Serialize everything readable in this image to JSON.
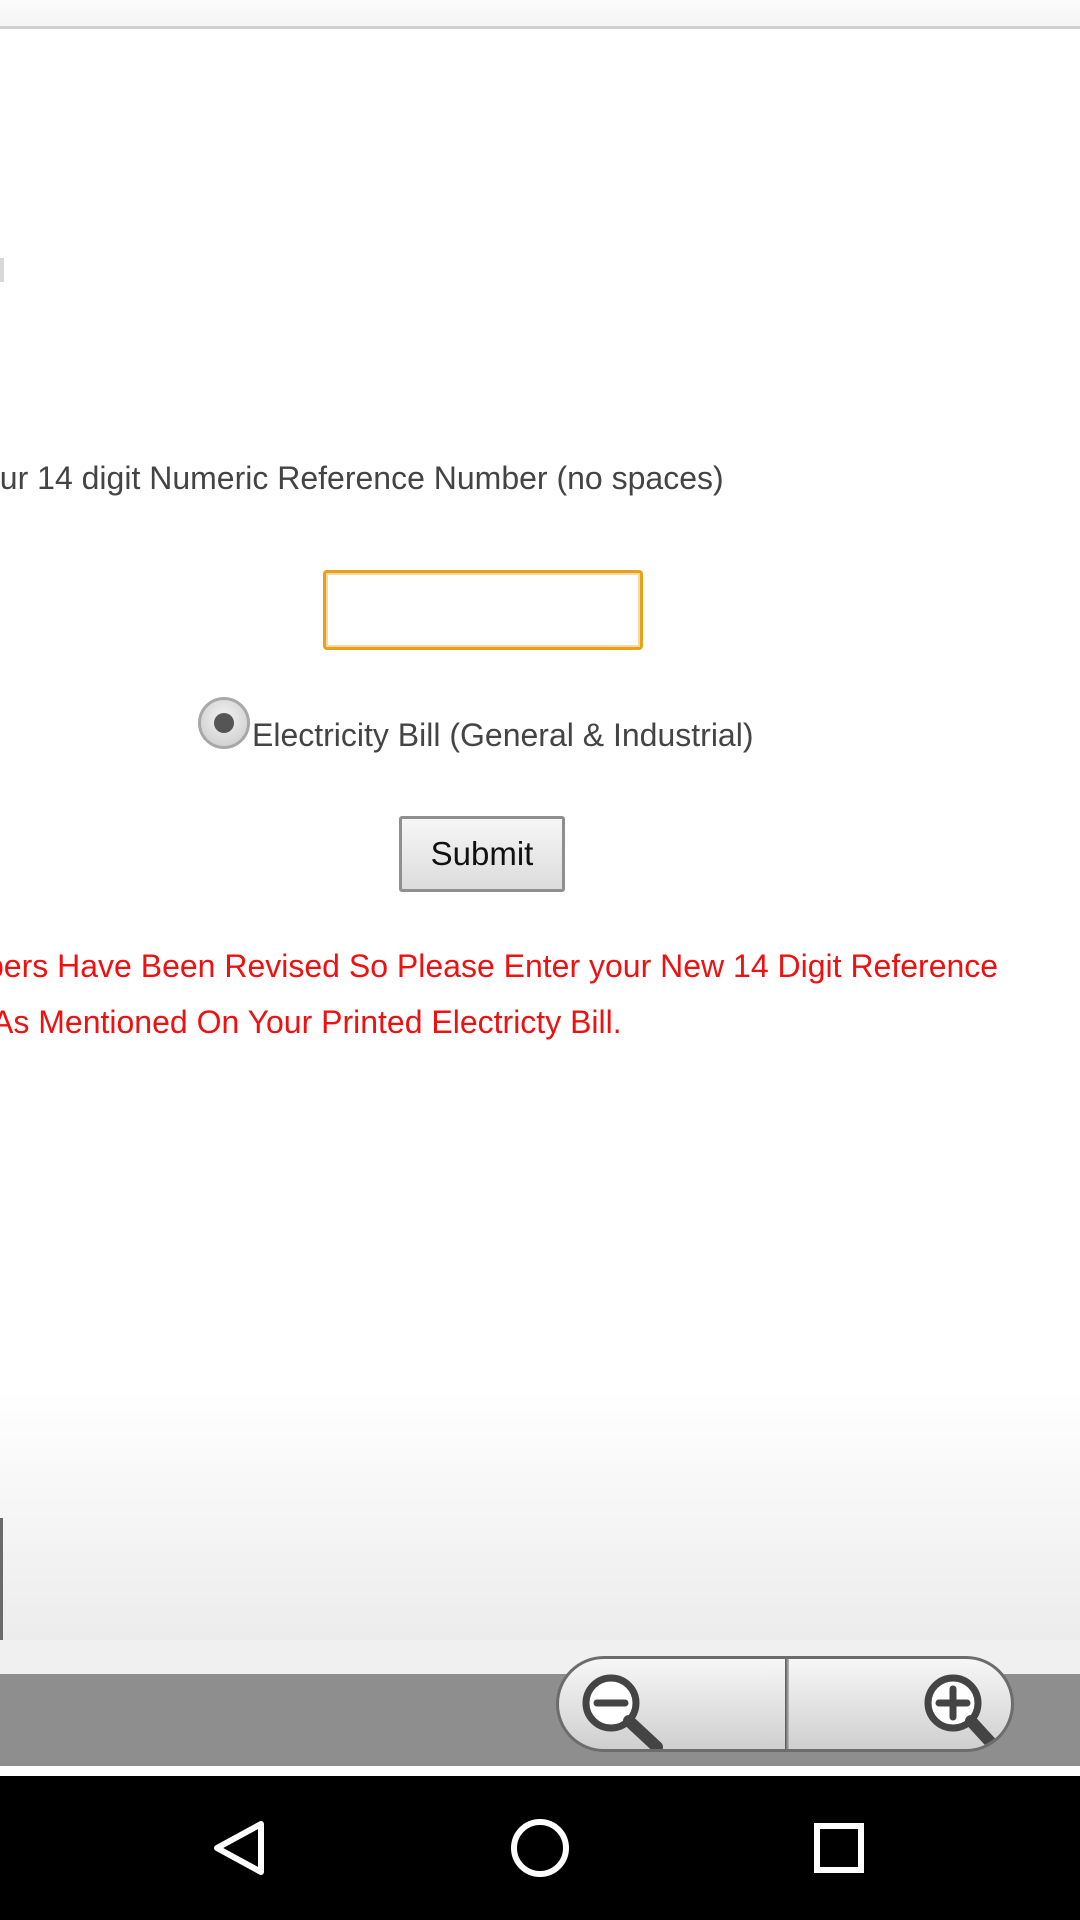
{
  "form": {
    "instruction": "our 14 digit Numeric Reference Number (no spaces)",
    "reference_input_value": "",
    "radio_label": "Electricity Bill (General & Industrial)",
    "submit_label": "Submit"
  },
  "notice": {
    "line1": "bers Have Been Revised So Please Enter your New 14 Digit Reference",
    "line2": "As Mentioned On Your Printed Electricty Bill."
  },
  "zoom_controls": {
    "zoom_out_icon": "zoom-out-magnifier-icon",
    "zoom_in_icon": "zoom-in-magnifier-icon"
  },
  "nav_bar": {
    "back_icon": "triangle-back-icon",
    "home_icon": "circle-home-icon",
    "recents_icon": "square-recents-icon"
  },
  "colors": {
    "notice_text": "#ee1111",
    "input_focus_border": "#e8a21a",
    "nav_background": "#000000"
  }
}
